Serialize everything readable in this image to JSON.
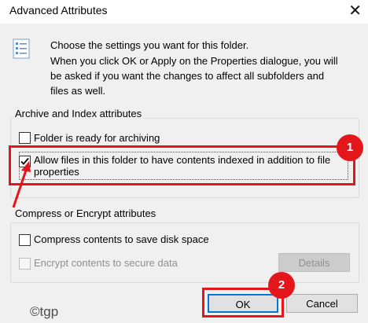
{
  "window": {
    "title": "Advanced Attributes",
    "close_glyph": "✕"
  },
  "intro": {
    "line1": "Choose the settings you want for this folder.",
    "line2": "When you click OK or Apply on the Properties dialogue, you will",
    "line3": "be asked if you want the changes to affect all subfolders and",
    "line4": "files as well."
  },
  "archive_group": {
    "label": "Archive and Index attributes",
    "folder_ready_label": "Folder is ready for archiving",
    "folder_ready_checked": false,
    "allow_index_line1": "Allow files in this folder to have contents indexed in addition to file",
    "allow_index_line2": "properties",
    "allow_index_checked": true
  },
  "compress_group": {
    "label": "Compress or Encrypt attributes",
    "compress_label": "Compress contents to save disk space",
    "compress_checked": false,
    "encrypt_label": "Encrypt contents to secure data",
    "encrypt_checked": false,
    "details_label": "Details"
  },
  "buttons": {
    "ok_label": "OK",
    "cancel_label": "Cancel"
  },
  "annotations": {
    "badge1": "1",
    "badge2": "2",
    "accent_color": "#e3161c"
  },
  "watermark": "©tgp"
}
